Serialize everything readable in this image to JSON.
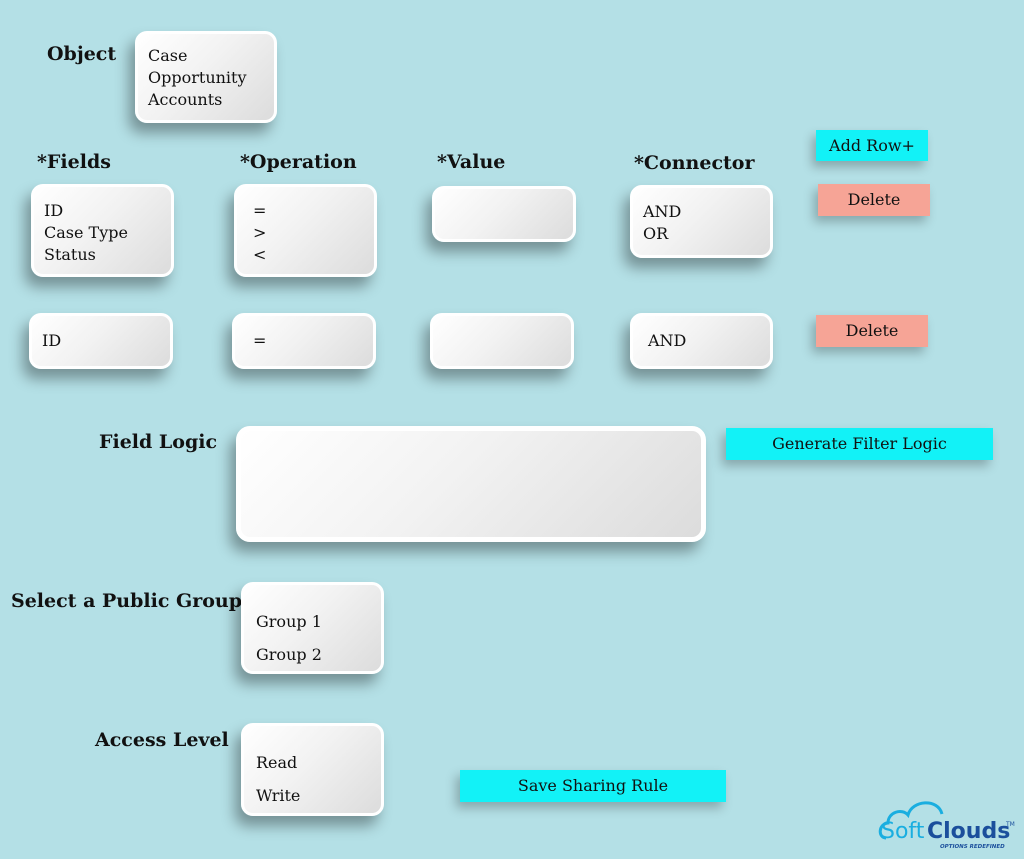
{
  "object": {
    "label": "Object",
    "options": [
      "Case",
      "Opportunity",
      "Accounts"
    ]
  },
  "headers": {
    "fields": "*Fields",
    "operation": "*Operation",
    "value": "*Value",
    "connector": "*Connector"
  },
  "rows": [
    {
      "fields": [
        "ID",
        "Case Type",
        "Status"
      ],
      "operation": [
        "=",
        ">",
        "<"
      ],
      "value": "",
      "connector": [
        "AND",
        "OR"
      ],
      "delete": "Delete"
    },
    {
      "fields": [
        "ID"
      ],
      "operation": [
        "="
      ],
      "value": "",
      "connector": [
        "AND"
      ],
      "delete": "Delete"
    }
  ],
  "add_row": "Add Row+",
  "field_logic": {
    "label": "Field Logic",
    "value": "",
    "button": "Generate Filter Logic"
  },
  "public_group": {
    "label": "Select a Public Group",
    "options": [
      "Group 1",
      "Group 2"
    ]
  },
  "access_level": {
    "label": "Access Level",
    "options": [
      "Read",
      "Write"
    ]
  },
  "save_button": "Save Sharing Rule",
  "logo": {
    "text_light": "Soft",
    "text_bold": "Clouds",
    "tagline": "OPTIONS REDEFINED",
    "tm": "™"
  },
  "colors": {
    "background": "#b4e0e6",
    "primary_button": "#12f2f7",
    "delete_button": "#f6a496"
  }
}
